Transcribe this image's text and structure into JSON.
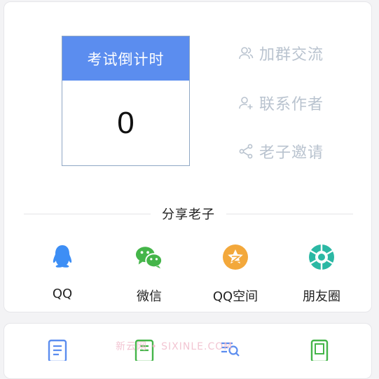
{
  "countdown": {
    "title": "考试倒计时",
    "value": "0"
  },
  "links": {
    "group": "加群交流",
    "contact": "联系作者",
    "invite": "老子邀请"
  },
  "share": {
    "heading": "分享老子",
    "items": [
      "QQ",
      "微信",
      "QQ空间",
      "朋友圈"
    ]
  },
  "watermark": "新云网 • SIXINLE.COM",
  "colors": {
    "accent": "#5b8def",
    "link": "#b9c3cf",
    "qq": "#3d8ef5",
    "wechat": "#44b549",
    "qzone": "#f3a83b",
    "moments": "#2bb8a4"
  }
}
